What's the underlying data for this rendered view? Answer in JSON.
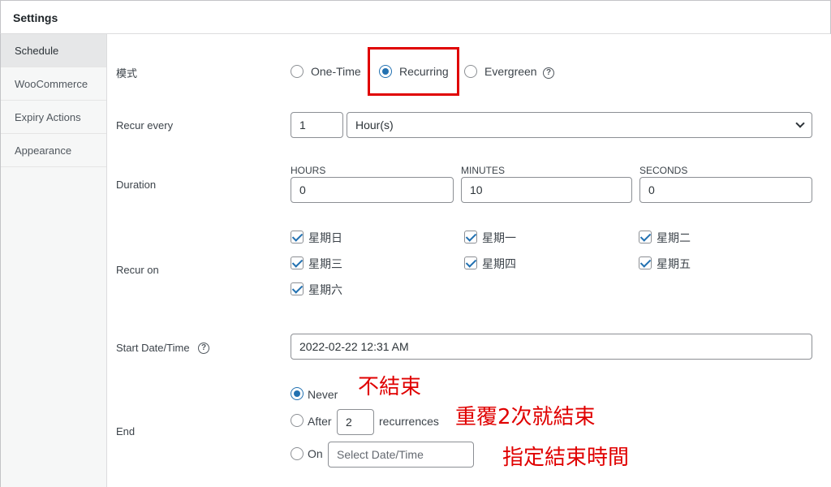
{
  "header": {
    "title": "Settings"
  },
  "sidebar": {
    "items": [
      {
        "label": "Schedule"
      },
      {
        "label": "WooCommerce"
      },
      {
        "label": "Expiry Actions"
      },
      {
        "label": "Appearance"
      }
    ]
  },
  "mode": {
    "label": "模式",
    "options": [
      {
        "label": "One-Time"
      },
      {
        "label": "Recurring"
      },
      {
        "label": "Evergreen"
      }
    ],
    "selected": "Recurring",
    "help_glyph": "?"
  },
  "recur_every": {
    "label": "Recur every",
    "value": "1",
    "unit": "Hour(s)"
  },
  "duration": {
    "label": "Duration",
    "hours_label": "HOURS",
    "hours": "0",
    "minutes_label": "MINUTES",
    "minutes": "10",
    "seconds_label": "SECONDS",
    "seconds": "0"
  },
  "recur_on": {
    "label": "Recur on",
    "days": [
      {
        "label": "星期日"
      },
      {
        "label": "星期一"
      },
      {
        "label": "星期二"
      },
      {
        "label": "星期三"
      },
      {
        "label": "星期四"
      },
      {
        "label": "星期五"
      },
      {
        "label": "星期六"
      }
    ]
  },
  "start": {
    "label": "Start Date/Time",
    "value": "2022-02-22 12:31 AM",
    "help_glyph": "?"
  },
  "end": {
    "label": "End",
    "never_label": "Never",
    "after_label": "After",
    "after_value": "2",
    "recurrences_label": "recurrences",
    "on_label": "On",
    "on_placeholder": "Select Date/Time",
    "selected": "Never"
  },
  "annotations": {
    "never": "不結束",
    "after": "重覆2次就結束",
    "on": "指定結束時間"
  },
  "colors": {
    "accent": "#2271b1",
    "annotation": "#e00000"
  }
}
